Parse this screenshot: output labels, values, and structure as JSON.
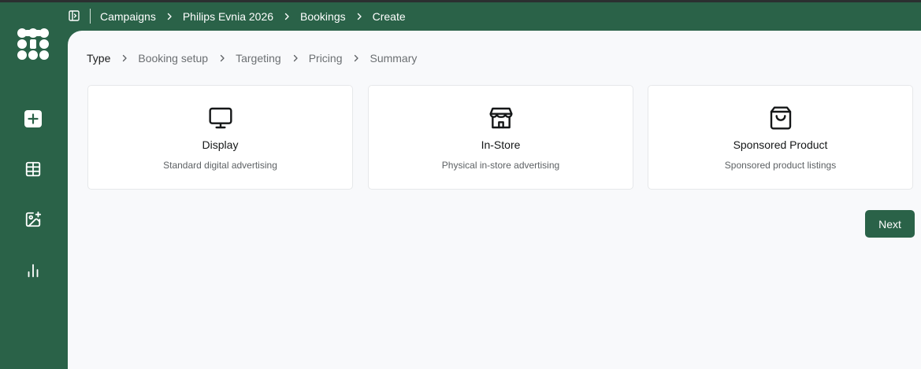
{
  "breadcrumbs": [
    "Campaigns",
    "Philips Evnia 2026",
    "Bookings",
    "Create"
  ],
  "sidebar": {
    "items": [
      {
        "icon": "plus-square-icon"
      },
      {
        "icon": "table-icon"
      },
      {
        "icon": "image-plus-icon"
      },
      {
        "icon": "bar-chart-icon"
      }
    ]
  },
  "steps": [
    "Type",
    "Booking setup",
    "Targeting",
    "Pricing",
    "Summary"
  ],
  "active_step": "Type",
  "cards": [
    {
      "icon": "monitor-icon",
      "title": "Display",
      "description": "Standard digital advertising"
    },
    {
      "icon": "store-icon",
      "title": "In-Store",
      "description": "Physical in-store advertising"
    },
    {
      "icon": "shopping-bag-icon",
      "title": "Sponsored Product",
      "description": "Sponsored product listings"
    }
  ],
  "next_label": "Next",
  "colors": {
    "brand": "#2a6248",
    "content_bg": "#f8f9fb",
    "card_border": "#e6e8ea"
  }
}
